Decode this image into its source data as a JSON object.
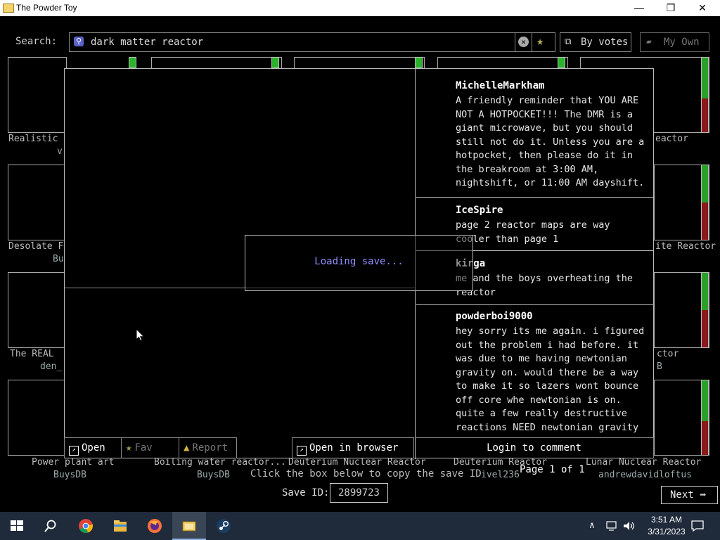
{
  "window": {
    "title": "The Powder Toy",
    "minimize": "—",
    "maximize": "❐",
    "close": "✕"
  },
  "search": {
    "label": "Search:",
    "value": "dark matter reactor",
    "sort_label": "By votes",
    "myown_label": "My Own"
  },
  "grid": {
    "row1_left_title": "Realistic",
    "row1_left_author": "v",
    "row1_right_title": "eactor",
    "row2_left_title": "Desolate F",
    "row2_left_author": "Bu",
    "row2_right_title": "ite Reactor",
    "row3_left_title": "The REAL",
    "row3_left_author": "den_",
    "row3_right_title": "ctor",
    "row3_right_author": "B",
    "bottom_titles": [
      "Power plant art",
      "Boiling water reactor...",
      "Deuterium Nuclear Reactor",
      "Deuterium Reactor",
      "Lunar Nuclear Reactor"
    ],
    "bottom_authors": [
      "BuysDB",
      "BuysDB",
      "",
      "ivel236",
      "andrewdavidloftus"
    ],
    "vote_right": [
      {
        "up": 0.5,
        "down": 0.5
      },
      {
        "up": 0.5,
        "down": 0.5
      },
      {
        "up": 0.5,
        "down": 0.5
      },
      {
        "up": 0.5,
        "down": 0.5
      }
    ]
  },
  "modal": {
    "loading_text": "Loading save...",
    "comments": [
      {
        "author": "MichelleMarkham",
        "text": "A friendly reminder that YOU ARE NOT A HOTPOCKET!!! The DMR is a giant microwave, but you should still not do it. Unless you are a hotpocket, then please do it in the breakroom at 3:00 AM, nightshift, or 11:00 AM dayshift."
      },
      {
        "author": "IceSpire",
        "text": "page 2 reactor maps are way cooler than page 1"
      },
      {
        "author": "kirga",
        "text": "me and the boys overheating the reactor"
      },
      {
        "author": "powderboi9000",
        "text": "hey sorry its me again. i figured out the problem i had before. it was due to me having newtonian gravity on. would there be a way to make it so lazers wont bounce off core whe newtonian is on. quite a few really destructive reactions NEED newtonian gravity"
      }
    ],
    "buttons": {
      "open": "Open",
      "fav": "Fav",
      "report": "Report",
      "open_browser": "Open in browser",
      "login": "Login to comment"
    }
  },
  "footer": {
    "copy_hint": "Click the box below to copy the save ID",
    "save_id_label": "Save ID:",
    "save_id": "2899723",
    "page_info": "Page 1 of 1",
    "next_label": "Next"
  },
  "taskbar": {
    "apps": [
      "start",
      "search",
      "chrome",
      "file-explorer",
      "firefox",
      "powder-toy",
      "steam"
    ],
    "time": "3:51 AM",
    "date": "3/31/2023"
  }
}
